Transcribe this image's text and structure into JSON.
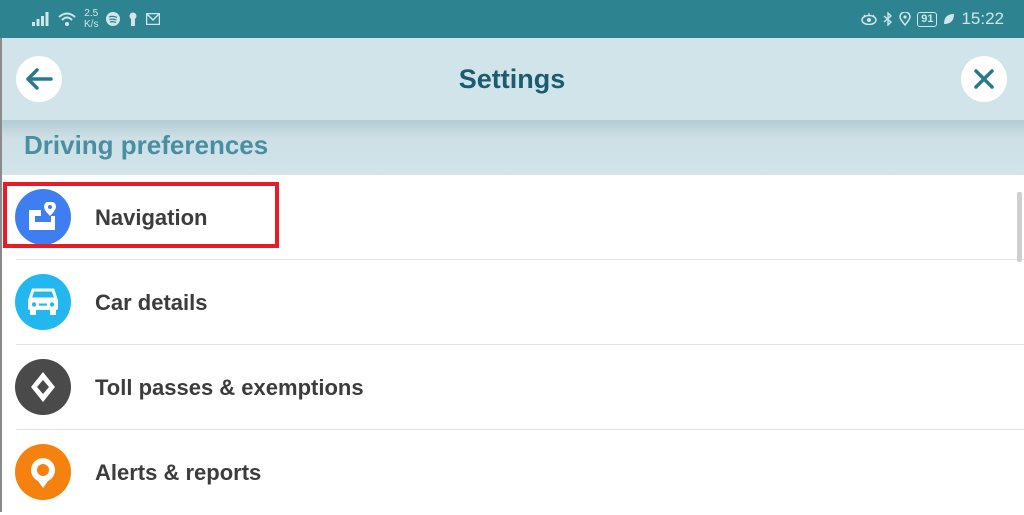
{
  "status_bar": {
    "network_speed_value": "2.5",
    "network_speed_unit": "K/s",
    "battery": "91",
    "time": "15:22",
    "left_icons": [
      "signal-icon",
      "wifi-icon",
      "spotify-icon",
      "keyhole-icon",
      "gmail-icon"
    ],
    "right_icons": [
      "eye-icon",
      "bluetooth-icon",
      "location-icon",
      "battery-icon",
      "leaf-icon"
    ]
  },
  "header": {
    "title": "Settings",
    "back_icon": "arrow-left-icon",
    "close_icon": "close-icon"
  },
  "section": {
    "title": "Driving preferences"
  },
  "items": [
    {
      "label": "Navigation",
      "icon": "map-pin-icon",
      "color": "#3f7ef0",
      "highlighted": true
    },
    {
      "label": "Car details",
      "icon": "car-icon",
      "color": "#22b8ef"
    },
    {
      "label": "Toll passes & exemptions",
      "icon": "diamond-icon",
      "color": "#4a4a4a"
    },
    {
      "label": "Alerts & reports",
      "icon": "alert-pin-icon",
      "color": "#f5820f"
    }
  ],
  "colors": {
    "status_bar": "#2e8391",
    "header_bg": "#d1e4ea",
    "title": "#1b5c6e",
    "section_title": "#4a8ea1",
    "highlight": "#e81c25"
  }
}
